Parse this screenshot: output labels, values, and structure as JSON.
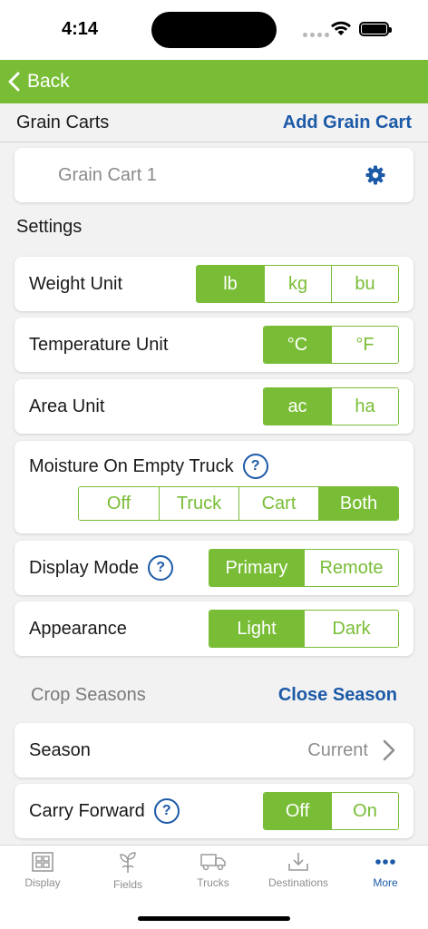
{
  "status": {
    "time": "4:14"
  },
  "nav": {
    "back_label": "Back"
  },
  "grain_carts": {
    "title": "Grain Carts",
    "add_label": "Add Grain Cart",
    "items": [
      {
        "name": "Grain Cart 1"
      }
    ]
  },
  "settings": {
    "title": "Settings",
    "weight_unit": {
      "label": "Weight Unit",
      "options": [
        "lb",
        "kg",
        "bu"
      ],
      "selected": "lb"
    },
    "temperature_unit": {
      "label": "Temperature Unit",
      "options": [
        "°C",
        "°F"
      ],
      "selected": "°C"
    },
    "area_unit": {
      "label": "Area Unit",
      "options": [
        "ac",
        "ha"
      ],
      "selected": "ac"
    },
    "moisture": {
      "label": "Moisture On Empty Truck",
      "help": "?",
      "options": [
        "Off",
        "Truck",
        "Cart",
        "Both"
      ],
      "selected": "Both"
    },
    "display_mode": {
      "label": "Display Mode",
      "help": "?",
      "options": [
        "Primary",
        "Remote"
      ],
      "selected": "Primary"
    },
    "appearance": {
      "label": "Appearance",
      "options": [
        "Light",
        "Dark"
      ],
      "selected": "Light"
    }
  },
  "crop_seasons": {
    "title": "Crop Seasons",
    "close_label": "Close Season",
    "season": {
      "label": "Season",
      "value": "Current"
    },
    "carry_forward": {
      "label": "Carry Forward",
      "help": "?",
      "options": [
        "Off",
        "On"
      ],
      "selected": "Off"
    }
  },
  "tabs": [
    {
      "label": "Display",
      "icon": "grid-icon"
    },
    {
      "label": "Fields",
      "icon": "sprout-icon"
    },
    {
      "label": "Trucks",
      "icon": "truck-icon"
    },
    {
      "label": "Destinations",
      "icon": "download-icon"
    },
    {
      "label": "More",
      "icon": "more-icon",
      "active": true
    }
  ],
  "colors": {
    "accent": "#79bd36",
    "link": "#1c5aa8",
    "background": "#f2f2f2"
  }
}
